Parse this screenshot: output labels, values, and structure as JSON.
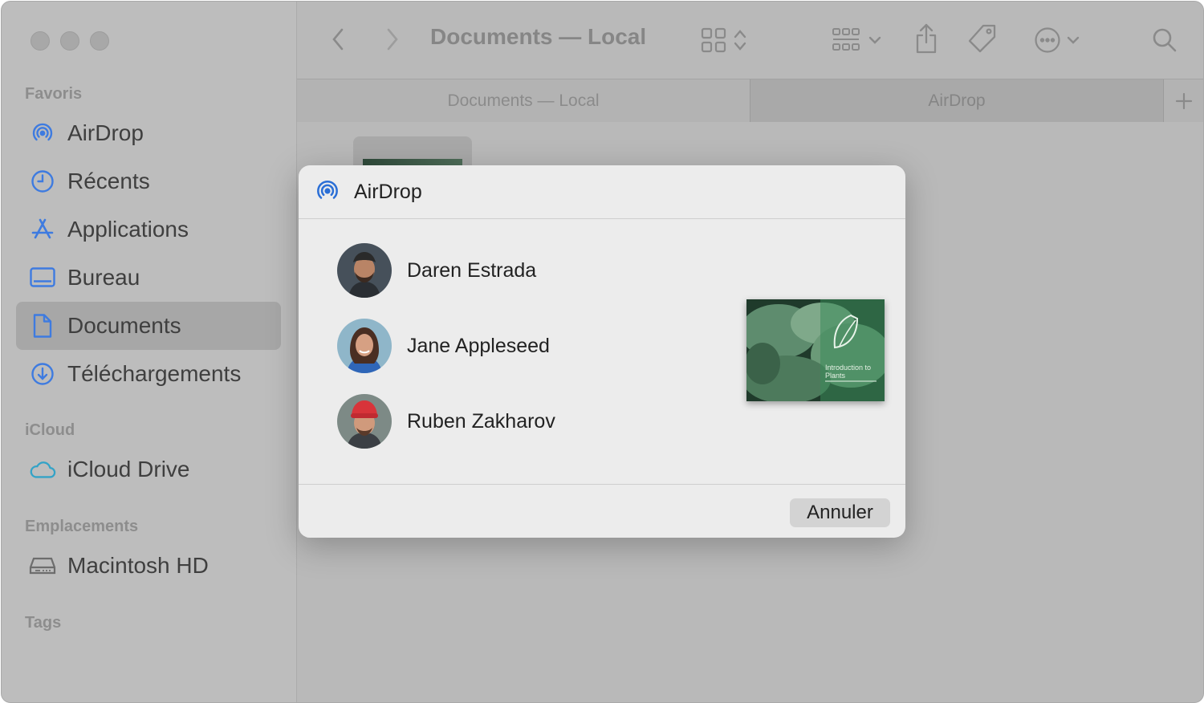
{
  "colors": {
    "accent": "#2b6fd6",
    "sidebar_icon": "#3e7be0",
    "icloud_icon": "#34a3c7"
  },
  "window": {
    "title": "Documents — Local"
  },
  "sidebar": {
    "sections": {
      "favorites": "Favoris",
      "icloud": "iCloud",
      "locations": "Emplacements",
      "tags": "Tags"
    },
    "favorites": [
      {
        "label": "AirDrop",
        "icon": "airdrop-icon"
      },
      {
        "label": "Récents",
        "icon": "clock-icon"
      },
      {
        "label": "Applications",
        "icon": "applications-icon"
      },
      {
        "label": "Bureau",
        "icon": "desktop-icon"
      },
      {
        "label": "Documents",
        "icon": "document-icon",
        "selected": true
      },
      {
        "label": "Téléchargements",
        "icon": "download-icon"
      }
    ],
    "icloud_items": [
      {
        "label": "iCloud Drive",
        "icon": "cloud-icon"
      }
    ],
    "location_items": [
      {
        "label": "Macintosh HD",
        "icon": "disk-icon"
      }
    ]
  },
  "tabs": [
    {
      "label": "Documents — Local",
      "active": false
    },
    {
      "label": "AirDrop",
      "active": true
    }
  ],
  "dialog": {
    "title": "AirDrop",
    "people": [
      {
        "name": "Daren Estrada"
      },
      {
        "name": "Jane Appleseed"
      },
      {
        "name": "Ruben Zakharov"
      }
    ],
    "preview_text": "Introduction to Plants",
    "cancel_label": "Annuler"
  }
}
